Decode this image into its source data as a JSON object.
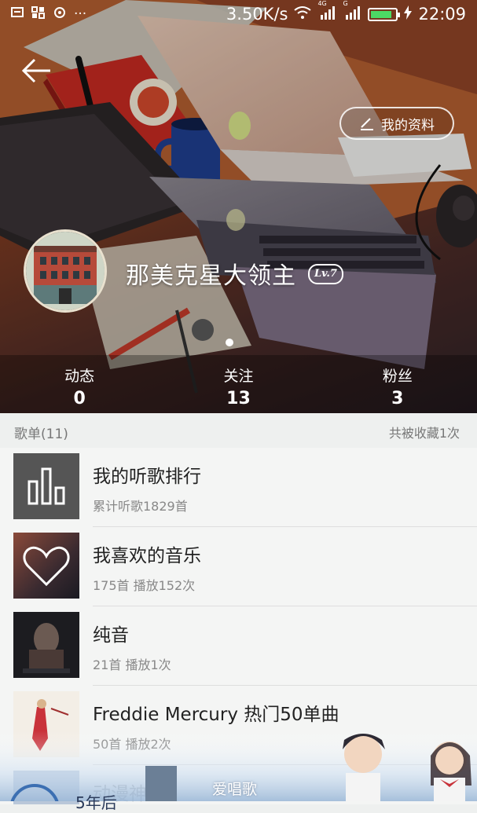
{
  "status_bar": {
    "left_icons": [
      "message-icon",
      "grid-icon",
      "sync-icon",
      "more-dots"
    ],
    "network_speed": "3.50K/s",
    "network_tag_1": "4G",
    "network_tag_2": "G",
    "time": "22:09"
  },
  "header": {
    "edit_profile_label": "我的资料",
    "username": "那美克星大领主",
    "level": "Lv.7"
  },
  "stats": [
    {
      "label": "动态",
      "value": "0"
    },
    {
      "label": "关注",
      "value": "13"
    },
    {
      "label": "粉丝",
      "value": "3"
    }
  ],
  "playlists_section": {
    "title": "歌单(11)",
    "collected": "共被收藏1次"
  },
  "playlists": [
    {
      "title": "我的听歌排行",
      "subtitle": "累计听歌1829首",
      "icon": "ranking-bars-icon"
    },
    {
      "title": "我喜欢的音乐",
      "subtitle": "175首 播放152次",
      "icon": "heart-icon"
    },
    {
      "title": "纯音",
      "subtitle": "21首 播放1次",
      "icon": "album-cover"
    },
    {
      "title": "Freddie Mercury 热门50单曲",
      "subtitle": "50首 播放2次",
      "icon": "album-cover"
    }
  ],
  "partial_row": {
    "title_fragment": "动漫神",
    "left_fragment": "5年后"
  },
  "watermark": "爱唱歌",
  "colors": {
    "battery": "#4cd964",
    "banner_base": "#7a3a22"
  }
}
